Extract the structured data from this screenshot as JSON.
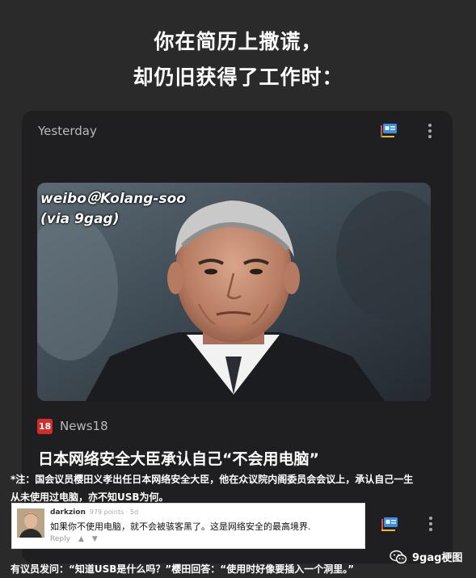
{
  "headline": {
    "line1": "你在简历上撒谎，",
    "line2": "却仍旧获得了工作时："
  },
  "card": {
    "date": "Yesterday",
    "watermark_line1": "weibo＠Kolang-soo",
    "watermark_line2": "(via 9gag)",
    "source_badge": "18",
    "source_name": "News18",
    "article_title": "日本网络安全大臣承认自己“不会用电脑”"
  },
  "note": {
    "line1": "*注：国会议员樱田义孝出任日本网络安全大臣，他在众议院内阁委员会会议上，承认自己一生",
    "line2": "从未使用过电脑，亦不知USB为何。"
  },
  "comment": {
    "username": "darkzion",
    "meta": "979 points · 5d",
    "text": "如果你不使用电脑，就不会被骇客黑了。这是网络安全的最高境界.",
    "reply": "Reply"
  },
  "bottom_note": "有议员发问：“知道USB是什么吗？”樱田回答：“使用时好像要插入一个洞里。”",
  "wechat_label": "9gag梗图",
  "icons": {
    "feed": "feed-icon",
    "more": "more-vertical-icon",
    "upvote": "upvote-icon",
    "downvote": "downvote-icon",
    "wechat": "wechat-icon"
  },
  "colors": {
    "background": "#2a2a2a",
    "card": "#1f1f21",
    "badge": "#d62b2b"
  }
}
